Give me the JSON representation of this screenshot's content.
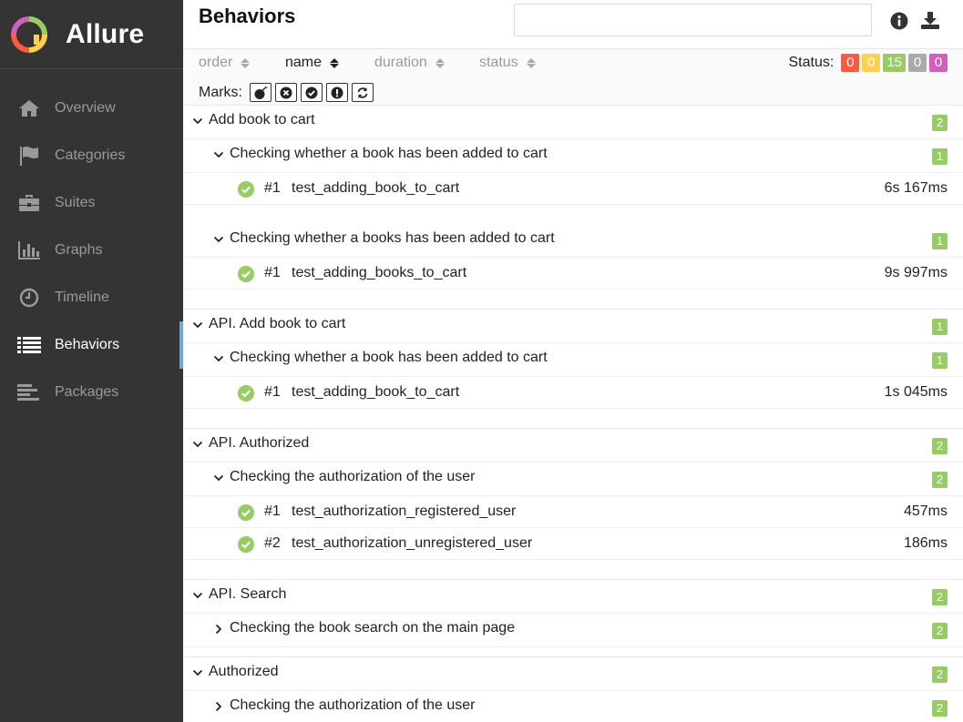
{
  "brand": {
    "name": "Allure"
  },
  "sidebar": {
    "items": [
      {
        "label": "Overview",
        "icon": "home-icon"
      },
      {
        "label": "Categories",
        "icon": "flag-icon"
      },
      {
        "label": "Suites",
        "icon": "briefcase-icon"
      },
      {
        "label": "Graphs",
        "icon": "bar-chart-icon"
      },
      {
        "label": "Timeline",
        "icon": "clock-icon"
      },
      {
        "label": "Behaviors",
        "icon": "list-icon",
        "active": true
      },
      {
        "label": "Packages",
        "icon": "align-left-icon"
      }
    ]
  },
  "header": {
    "title": "Behaviors",
    "search_value": ""
  },
  "toolbar": {
    "sorters": [
      {
        "label": "order"
      },
      {
        "label": "name",
        "active": true
      },
      {
        "label": "duration"
      },
      {
        "label": "status"
      }
    ],
    "status_label": "Status:",
    "status_counts": [
      {
        "value": "0",
        "color": "#fd5a3e",
        "status": "failed"
      },
      {
        "value": "0",
        "color": "#ffd050",
        "status": "broken"
      },
      {
        "value": "15",
        "color": "#97cc64",
        "status": "passed"
      },
      {
        "value": "0",
        "color": "#aaaaaa",
        "status": "skipped"
      },
      {
        "value": "0",
        "color": "#d35ebe",
        "status": "unknown"
      }
    ],
    "marks_label": "Marks:",
    "marks": [
      "flaky-bomb-icon",
      "new-failed-icon",
      "new-passed-icon",
      "new-broken-icon",
      "retries-icon"
    ]
  },
  "tree": {
    "groups": [
      {
        "name": "Add book to cart",
        "count": "2",
        "children": [
          {
            "name": "Checking whether a book has been added to cart",
            "count": "1",
            "expanded": true,
            "tests": [
              {
                "order": "#1",
                "name": "test_adding_book_to_cart",
                "duration": "6s 167ms"
              }
            ]
          },
          {
            "name": "Checking whether a books has been added to cart",
            "count": "1",
            "expanded": true,
            "tests": [
              {
                "order": "#1",
                "name": "test_adding_books_to_cart",
                "duration": "9s 997ms"
              }
            ]
          }
        ]
      },
      {
        "name": "API. Add book to cart",
        "count": "1",
        "children": [
          {
            "name": "Checking whether a book has been added to cart",
            "count": "1",
            "expanded": true,
            "tests": [
              {
                "order": "#1",
                "name": "test_adding_book_to_cart",
                "duration": "1s 045ms"
              }
            ]
          }
        ]
      },
      {
        "name": "API. Authorized",
        "count": "2",
        "children": [
          {
            "name": "Checking the authorization of the user",
            "count": "2",
            "expanded": true,
            "tests": [
              {
                "order": "#1",
                "name": "test_authorization_registered_user",
                "duration": "457ms"
              },
              {
                "order": "#2",
                "name": "test_authorization_unregistered_user",
                "duration": "186ms"
              }
            ]
          }
        ]
      },
      {
        "name": "API. Search",
        "count": "2",
        "children": [
          {
            "name": "Checking the book search on the main page",
            "count": "2",
            "expanded": false,
            "tests": []
          }
        ]
      },
      {
        "name": "Authorized",
        "count": "2",
        "children": [
          {
            "name": "Checking the authorization of the user",
            "count": "2",
            "expanded": false,
            "tests": []
          }
        ]
      }
    ]
  }
}
